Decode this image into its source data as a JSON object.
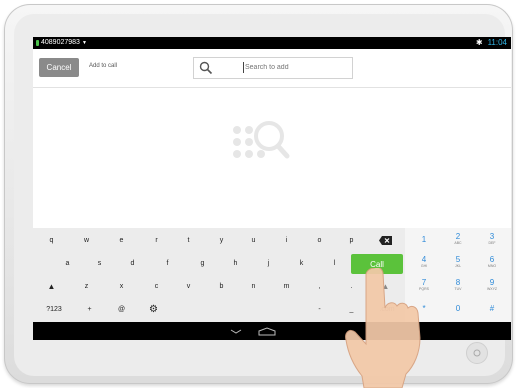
{
  "statusbar": {
    "phone_number": "4089027983",
    "time": "11:04",
    "bluetooth_icon": "bluetooth-icon"
  },
  "actionbar": {
    "cancel_label": "Cancel",
    "title": "Add to call",
    "search_placeholder": "Search to add"
  },
  "keyboard": {
    "row1": [
      "q",
      "w",
      "e",
      "r",
      "t",
      "y",
      "u",
      "i",
      "o",
      "p"
    ],
    "row2": [
      "a",
      "s",
      "d",
      "f",
      "g",
      "h",
      "j",
      "k",
      "l"
    ],
    "row3": [
      "z",
      "x",
      "c",
      "v",
      "b",
      "n",
      "m",
      ",",
      "."
    ],
    "row4": {
      "sym": "?123",
      "plus": "+",
      "at": "@",
      "dash": "-",
      "underscore": "_",
      "com": ".com"
    },
    "call_label": "Call"
  },
  "numpad": [
    {
      "digit": "1",
      "sub": ""
    },
    {
      "digit": "2",
      "sub": "ABC"
    },
    {
      "digit": "3",
      "sub": "DEF"
    },
    {
      "digit": "4",
      "sub": "GHI"
    },
    {
      "digit": "5",
      "sub": "JKL"
    },
    {
      "digit": "6",
      "sub": "MNO"
    },
    {
      "digit": "7",
      "sub": "PQRS"
    },
    {
      "digit": "8",
      "sub": "TUV"
    },
    {
      "digit": "9",
      "sub": "WXYZ"
    },
    {
      "digit": "*",
      "sub": ""
    },
    {
      "digit": "0",
      "sub": ""
    },
    {
      "digit": "#",
      "sub": ""
    }
  ],
  "colors": {
    "call_green": "#5bc23b",
    "cancel_gray": "#8a8a8a",
    "numpad_blue": "#2e8ad8",
    "time_blue": "#33b5e5"
  }
}
